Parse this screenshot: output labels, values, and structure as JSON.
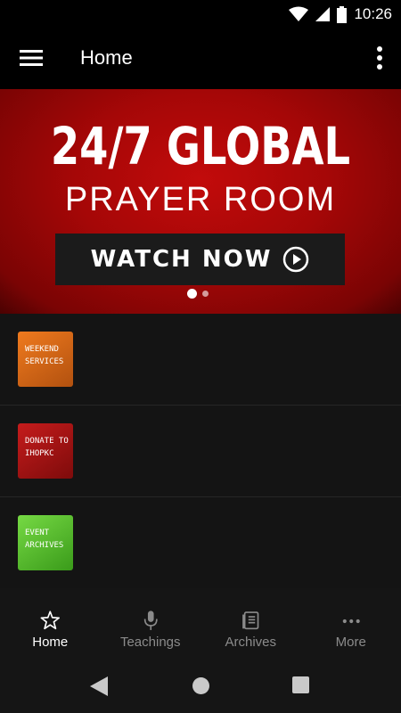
{
  "status_bar": {
    "time": "10:26"
  },
  "app_bar": {
    "title": "Home"
  },
  "banner": {
    "title": "24/7 GLOBAL",
    "subtitle": "PRAYER ROOM",
    "button_label": "WATCH NOW",
    "page_index": 1,
    "page_count": 2
  },
  "list": {
    "items": [
      {
        "thumb_line1": "WEEKEND",
        "thumb_line2": "SERVICES",
        "color": "#d9651a"
      },
      {
        "thumb_line1": "DONATE TO",
        "thumb_line2": "IHOPKC",
        "color": "#b31414"
      },
      {
        "thumb_line1": "EVENT",
        "thumb_line2": "ARCHIVES",
        "color": "#5ec232"
      }
    ]
  },
  "bottom_nav": {
    "items": [
      {
        "label": "Home",
        "icon": "star-icon",
        "active": true
      },
      {
        "label": "Teachings",
        "icon": "microphone-icon",
        "active": false
      },
      {
        "label": "Archives",
        "icon": "book-icon",
        "active": false
      },
      {
        "label": "More",
        "icon": "more-horizontal-icon",
        "active": false
      }
    ]
  },
  "colors": {
    "banner_red": "#a50707",
    "background": "#141414",
    "nav_inactive": "#8b8b8b"
  }
}
